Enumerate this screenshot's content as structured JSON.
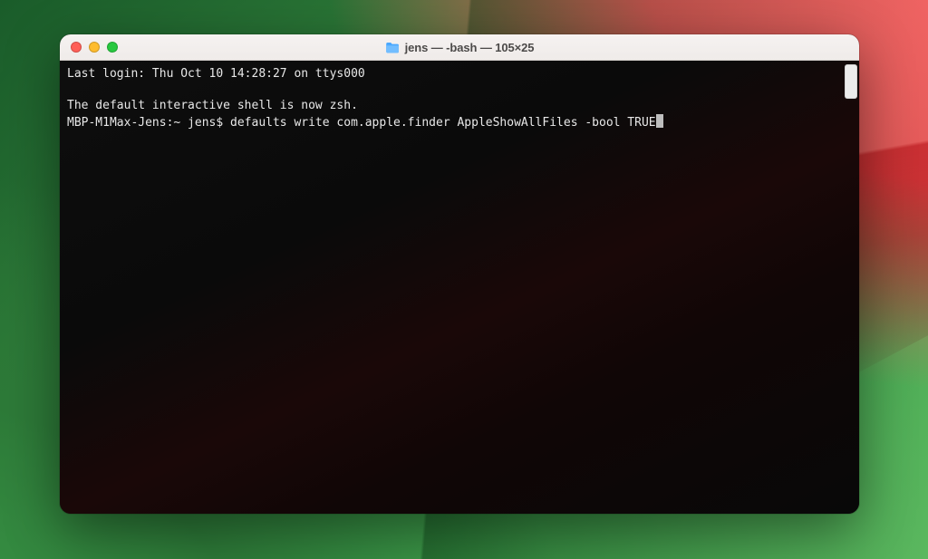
{
  "window": {
    "title": "jens — -bash — 105×25"
  },
  "terminal": {
    "line1": "Last login: Thu Oct 10 14:28:27 on ttys000",
    "blank1": " ",
    "line2": "The default interactive shell is now zsh.",
    "prompt": "MBP-M1Max-Jens:~ jens$ ",
    "command": "defaults write com.apple.finder AppleShowAllFiles -bool TRUE"
  }
}
